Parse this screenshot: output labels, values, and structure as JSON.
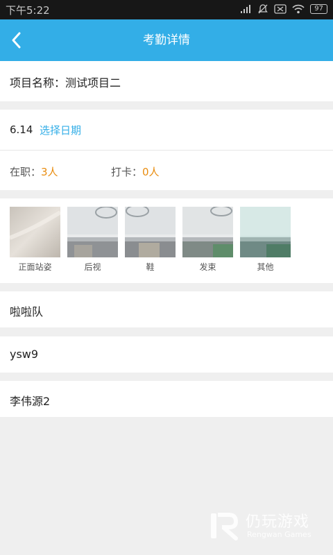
{
  "status_bar": {
    "time": "下午5:22",
    "battery": "97"
  },
  "header": {
    "title": "考勤详情"
  },
  "project": {
    "text": "项目名称：测试项目二"
  },
  "date": {
    "value": "6.14",
    "select_label": "选择日期"
  },
  "stats": {
    "on_duty_label": "在职：",
    "on_duty_value": "3人",
    "checkin_label": "打卡：",
    "checkin_value": "0人"
  },
  "photos": [
    {
      "caption": "正面站姿"
    },
    {
      "caption": "后视"
    },
    {
      "caption": "鞋"
    },
    {
      "caption": "发束"
    },
    {
      "caption": "其他"
    }
  ],
  "groups": [
    "啦啦队",
    "ysw9",
    "李伟源2"
  ],
  "watermark": {
    "name": "仍玩游戏",
    "name_en": "Rengwan Games"
  },
  "colors": {
    "accent": "#33aee7",
    "highlight": "#e98d10"
  }
}
